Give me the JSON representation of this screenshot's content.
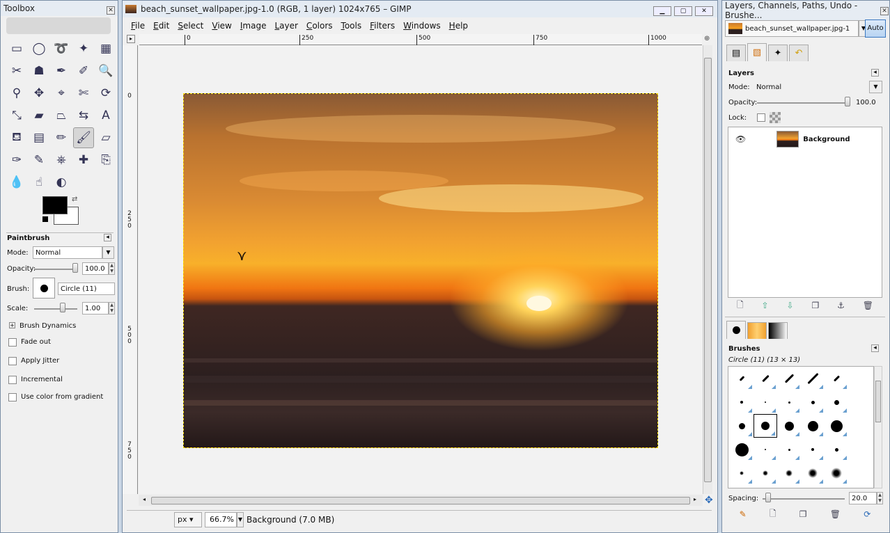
{
  "toolbox": {
    "title": "Toolbox",
    "tools": [
      {
        "name": "rect-select-icon",
        "glyph": "▭"
      },
      {
        "name": "ellipse-select-icon",
        "glyph": "◯"
      },
      {
        "name": "free-select-icon",
        "glyph": "➰"
      },
      {
        "name": "fuzzy-select-icon",
        "glyph": "✦"
      },
      {
        "name": "color-select-icon",
        "glyph": "▦"
      },
      {
        "name": "scissors-icon",
        "glyph": "✂"
      },
      {
        "name": "foreground-select-icon",
        "glyph": "☗"
      },
      {
        "name": "paths-icon",
        "glyph": "✒"
      },
      {
        "name": "color-picker-icon",
        "glyph": "✐"
      },
      {
        "name": "zoom-icon",
        "glyph": "🔍"
      },
      {
        "name": "measure-icon",
        "glyph": "⚲"
      },
      {
        "name": "move-icon",
        "glyph": "✥"
      },
      {
        "name": "align-icon",
        "glyph": "⌖"
      },
      {
        "name": "crop-icon",
        "glyph": "✄"
      },
      {
        "name": "rotate-icon",
        "glyph": "⟳"
      },
      {
        "name": "scale-icon",
        "glyph": "⤡"
      },
      {
        "name": "shear-icon",
        "glyph": "▰"
      },
      {
        "name": "perspective-icon",
        "glyph": "⏢"
      },
      {
        "name": "flip-icon",
        "glyph": "⇆"
      },
      {
        "name": "text-icon",
        "glyph": "A"
      },
      {
        "name": "bucket-fill-icon",
        "glyph": "⛾"
      },
      {
        "name": "blend-icon",
        "glyph": "▤"
      },
      {
        "name": "pencil-icon",
        "glyph": "✏"
      },
      {
        "name": "paintbrush-icon",
        "glyph": "🖌"
      },
      {
        "name": "eraser-icon",
        "glyph": "▱"
      },
      {
        "name": "airbrush-icon",
        "glyph": "✑"
      },
      {
        "name": "ink-icon",
        "glyph": "✎"
      },
      {
        "name": "clone-icon",
        "glyph": "⎈"
      },
      {
        "name": "heal-icon",
        "glyph": "✚"
      },
      {
        "name": "perspective-clone-icon",
        "glyph": "⎘"
      },
      {
        "name": "blur-icon",
        "glyph": "💧"
      },
      {
        "name": "smudge-icon",
        "glyph": "☝"
      },
      {
        "name": "dodge-burn-icon",
        "glyph": "◐"
      }
    ],
    "active_tool_index": 23,
    "fg_color": "#000000",
    "bg_color": "#ffffff",
    "options": {
      "title": "Paintbrush",
      "mode_label": "Mode:",
      "mode_value": "Normal",
      "opacity_label": "Opacity:",
      "opacity_value": "100.0",
      "brush_label": "Brush:",
      "brush_value": "Circle (11)",
      "scale_label": "Scale:",
      "scale_value": "1.00",
      "dynamics_label": "Brush Dynamics",
      "fade_label": "Fade out",
      "jitter_label": "Apply Jitter",
      "incremental_label": "Incremental",
      "gradient_label": "Use color from gradient"
    }
  },
  "image_window": {
    "title": "beach_sunset_wallpaper.jpg-1.0 (RGB, 1 layer) 1024x765 – GIMP",
    "menu": [
      "File",
      "Edit",
      "Select",
      "View",
      "Image",
      "Layer",
      "Colors",
      "Tools",
      "Filters",
      "Windows",
      "Help"
    ],
    "ruler_h": [
      "0",
      "250",
      "500",
      "750",
      "1000"
    ],
    "ruler_v": [
      "0",
      "250",
      "500",
      "750"
    ],
    "status": {
      "unit": "px",
      "zoom": "66.7%",
      "info": "Background (7.0 MB)"
    }
  },
  "dock": {
    "title": "Layers, Channels, Paths, Undo - Brushe...",
    "image_selector": "beach_sunset_wallpaper.jpg-1",
    "auto_label": "Auto",
    "layers": {
      "title": "Layers",
      "mode_label": "Mode:",
      "mode_value": "Normal",
      "opacity_label": "Opacity:",
      "opacity_value": "100.0",
      "lock_label": "Lock:",
      "items": [
        {
          "name": "Background",
          "visible": true
        }
      ]
    },
    "brushes": {
      "title": "Brushes",
      "selected": "Circle (11) (13 × 13)",
      "spacing_label": "Spacing:",
      "spacing_value": "20.0"
    }
  }
}
